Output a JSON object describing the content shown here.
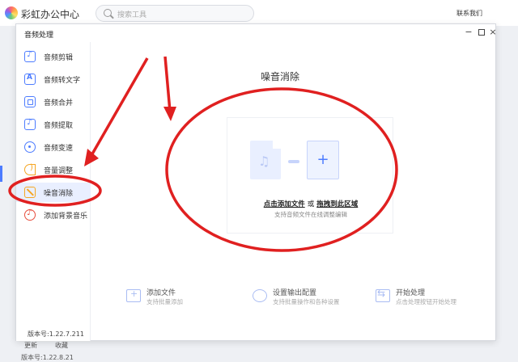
{
  "app": {
    "title": "彩虹办公中心",
    "search_placeholder": "搜索工具",
    "contact": "联系我们",
    "bottom_left_a": "更新",
    "bottom_left_b": "收藏",
    "bottom_version": "版本号:1.22.8.21"
  },
  "dialog": {
    "title": "音频处理",
    "controls": {
      "minimize": "−",
      "close": "×"
    },
    "sidebar": [
      {
        "label": "音频剪辑",
        "icon": "scissors-note-icon"
      },
      {
        "label": "音频转文字",
        "icon": "text-a-icon"
      },
      {
        "label": "音频合并",
        "icon": "merge-icon"
      },
      {
        "label": "音频提取",
        "icon": "note-icon"
      },
      {
        "label": "音频变速",
        "icon": "speed-icon"
      },
      {
        "label": "音量调整",
        "icon": "volume-icon"
      },
      {
        "label": "噪音消除",
        "icon": "noise-icon",
        "active": true
      },
      {
        "label": "添加背景音乐",
        "icon": "background-music-icon"
      }
    ],
    "version": "版本号:1.22.7.211",
    "main": {
      "title": "噪音消除",
      "drop": {
        "click_add": "点击添加文件",
        "or": "或",
        "drag_here": "拖拽到此区域",
        "sub": "支持音频文件在线调整编辑",
        "plus": "+"
      },
      "actions": [
        {
          "title": "添加文件",
          "sub": "支持批量添加"
        },
        {
          "title": "设置输出配置",
          "sub": "支持批量操作和各种设置"
        },
        {
          "title": "开始处理",
          "sub": "点击处理按钮开始处理"
        }
      ]
    }
  },
  "colors": {
    "accent": "#4d7cff",
    "annotation": "#e02020",
    "active_bg": "#e9efff"
  }
}
